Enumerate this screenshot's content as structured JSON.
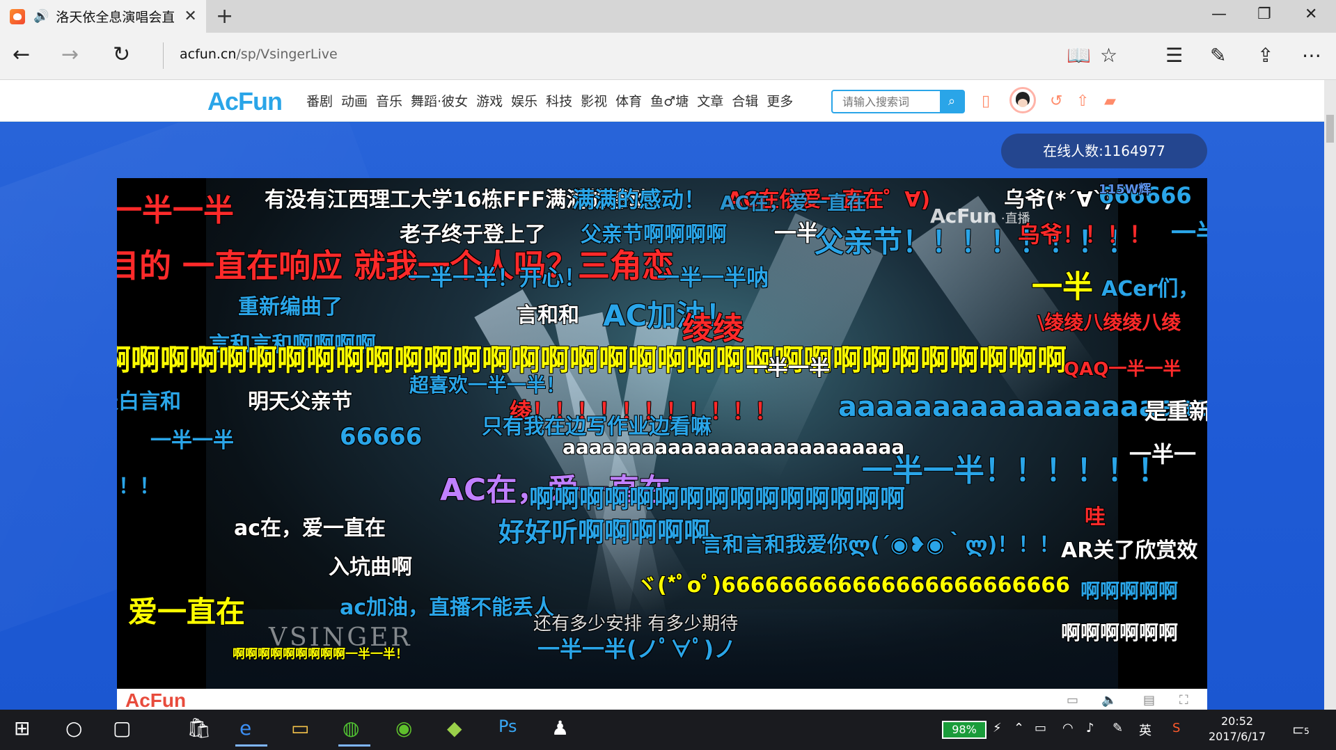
{
  "browser": {
    "tab_title": "洛天依全息演唱会直",
    "url_host": "acfun.cn",
    "url_path": "/sp/VsingerLive"
  },
  "site": {
    "logo": "AcFun",
    "menu": [
      "番剧",
      "动画",
      "音乐",
      "舞蹈·彼女",
      "游戏",
      "娱乐",
      "科技",
      "影视",
      "体育",
      "鱼♂塘",
      "文章",
      "合辑",
      "更多"
    ],
    "search_placeholder": "请输入搜索词"
  },
  "live": {
    "online_count": "在线人数:1164977",
    "watermark": "AcFun",
    "watermark_live": "·直播",
    "stage_caption": "VSINGER",
    "lyric": "还有多少安排 有多少期待"
  },
  "danmaku": [
    {
      "text": "一半一半",
      "color": "#ff2a2a"
    },
    {
      "text": "有没有江西理工大学16栋FFF满满的感动！",
      "color": "#ffffff"
    },
    {
      "text": "满满的感动！",
      "color": "#2aa5e8"
    },
    {
      "text": "AC在依爱一直在゜∀)",
      "color": "#ff2a2a"
    },
    {
      "text": "AC在，爱一直在",
      "color": "#2aa5e8"
    },
    {
      "text": "乌爷(*´∀`)",
      "color": "#ffffff"
    },
    {
      "text": "666666",
      "color": "#2aa5e8"
    },
    {
      "text": "115W辉",
      "color": "#5a8fe8"
    },
    {
      "text": "老子终于登上了",
      "color": "#ffffff"
    },
    {
      "text": "父亲节啊啊啊啊",
      "color": "#2aa5e8"
    },
    {
      "text": "一半",
      "color": "#ffffff"
    },
    {
      "text": "父亲节！！！！！！！！",
      "color": "#2aa5e8"
    },
    {
      "text": "乌爷！！！！",
      "color": "#ff2a2a"
    },
    {
      "text": "一半",
      "color": "#2aa5e8"
    },
    {
      "text": "目的 一直在响应 就我一个人吗？三角恋",
      "color": "#ff2a2a"
    },
    {
      "text": "一半一半！开心！",
      "color": "#2aa5e8"
    },
    {
      "text": "一半一半呐",
      "color": "#2aa5e8"
    },
    {
      "text": "一半",
      "color": "#ffff00"
    },
    {
      "text": "ACer们，",
      "color": "#2aa5e8"
    },
    {
      "text": "重新编曲了",
      "color": "#2aa5e8"
    },
    {
      "text": "言和和",
      "color": "#ffffff"
    },
    {
      "text": "AC加油！",
      "color": "#2aa5e8"
    },
    {
      "text": "绫绫",
      "color": "#ff2a2a"
    },
    {
      "text": "\\绫绫八绫绫八绫",
      "color": "#ff2a2a"
    },
    {
      "text": "言和言和啊啊啊啊",
      "color": "#2aa5e8"
    },
    {
      "text": "啊啊啊啊啊啊啊啊啊啊啊啊啊啊啊啊啊啊啊啊啊啊啊啊啊啊啊啊啊啊啊啊啊",
      "color": "#ffff00"
    },
    {
      "text": "一半一半",
      "color": "#ffffff"
    },
    {
      "text": "QAQ一半一半",
      "color": "#ff2a2a"
    },
    {
      "text": "天白言和",
      "color": "#2aa5e8"
    },
    {
      "text": "明天父亲节",
      "color": "#ffffff"
    },
    {
      "text": "超喜欢一半一半！",
      "color": "#2aa5e8"
    },
    {
      "text": "绫！！！！！！！！！！！",
      "color": "#ff2a2a"
    },
    {
      "text": "只有我在边写作业边看嘛",
      "color": "#2aa5e8"
    },
    {
      "text": "aaaaaaaaaaaaaaaaaaaaa",
      "color": "#2aa5e8"
    },
    {
      "text": "是重新",
      "color": "#ffffff"
    },
    {
      "text": "一半一半",
      "color": "#2aa5e8"
    },
    {
      "text": "66666",
      "color": "#2aa5e8"
    },
    {
      "text": "aaaaaaaaaaaaaaaaaaaaaaaaaa",
      "color": "#ffffff"
    },
    {
      "text": "一半一半！！！！！！",
      "color": "#2aa5e8"
    },
    {
      "text": "一半一",
      "color": "#ffffff"
    },
    {
      "text": "！！",
      "color": "#2aa5e8"
    },
    {
      "text": "AC在，爱一直在",
      "color": "#c080ff"
    },
    {
      "text": "啊啊啊啊啊啊啊啊啊啊啊啊啊啊啊",
      "color": "#2aa5e8"
    },
    {
      "text": "ac在，爱一直在",
      "color": "#ffffff"
    },
    {
      "text": "好好听啊啊啊啊啊",
      "color": "#2aa5e8"
    },
    {
      "text": "哇",
      "color": "#ff2a2a"
    },
    {
      "text": "言和言和我爱你ლ(´◉❥◉｀ლ)！！！",
      "color": "#2aa5e8"
    },
    {
      "text": "AR关了欣赏效",
      "color": "#ffffff"
    },
    {
      "text": "入坑曲啊",
      "color": "#ffffff"
    },
    {
      "text": "ヾ(*ﾟoﾟ)666666666666666666666666",
      "color": "#ffff00"
    },
    {
      "text": "啊啊啊啊啊",
      "color": "#2aa5e8"
    },
    {
      "text": "爱一直在",
      "color": "#ffff00"
    },
    {
      "text": "ac加油，直播不能丢人",
      "color": "#2aa5e8"
    },
    {
      "text": "啊啊啊啊啊啊",
      "color": "#ffffff"
    },
    {
      "text": "一半一半(ノﾟ∀ﾟ)ノ",
      "color": "#2aa5e8"
    },
    {
      "text": "啊啊啊啊啊啊啊啊啊一半一半！",
      "color": "#ffff00"
    }
  ],
  "taskbar": {
    "battery": "98%",
    "ime": "英",
    "time": "20:52",
    "date": "2017/6/17",
    "notifications": "5"
  }
}
